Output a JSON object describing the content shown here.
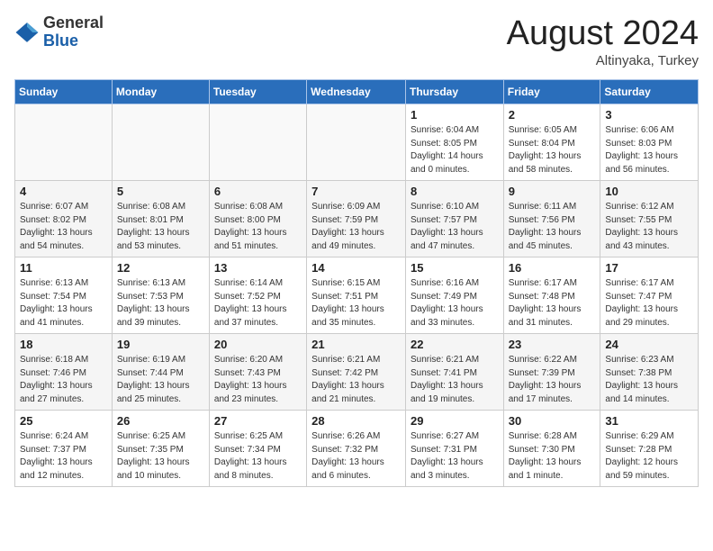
{
  "header": {
    "logo_general": "General",
    "logo_blue": "Blue",
    "month_title": "August 2024",
    "location": "Altinyaka, Turkey"
  },
  "weekdays": [
    "Sunday",
    "Monday",
    "Tuesday",
    "Wednesday",
    "Thursday",
    "Friday",
    "Saturday"
  ],
  "weeks": [
    [
      {
        "day": "",
        "info": ""
      },
      {
        "day": "",
        "info": ""
      },
      {
        "day": "",
        "info": ""
      },
      {
        "day": "",
        "info": ""
      },
      {
        "day": "1",
        "info": "Sunrise: 6:04 AM\nSunset: 8:05 PM\nDaylight: 14 hours\nand 0 minutes."
      },
      {
        "day": "2",
        "info": "Sunrise: 6:05 AM\nSunset: 8:04 PM\nDaylight: 13 hours\nand 58 minutes."
      },
      {
        "day": "3",
        "info": "Sunrise: 6:06 AM\nSunset: 8:03 PM\nDaylight: 13 hours\nand 56 minutes."
      }
    ],
    [
      {
        "day": "4",
        "info": "Sunrise: 6:07 AM\nSunset: 8:02 PM\nDaylight: 13 hours\nand 54 minutes."
      },
      {
        "day": "5",
        "info": "Sunrise: 6:08 AM\nSunset: 8:01 PM\nDaylight: 13 hours\nand 53 minutes."
      },
      {
        "day": "6",
        "info": "Sunrise: 6:08 AM\nSunset: 8:00 PM\nDaylight: 13 hours\nand 51 minutes."
      },
      {
        "day": "7",
        "info": "Sunrise: 6:09 AM\nSunset: 7:59 PM\nDaylight: 13 hours\nand 49 minutes."
      },
      {
        "day": "8",
        "info": "Sunrise: 6:10 AM\nSunset: 7:57 PM\nDaylight: 13 hours\nand 47 minutes."
      },
      {
        "day": "9",
        "info": "Sunrise: 6:11 AM\nSunset: 7:56 PM\nDaylight: 13 hours\nand 45 minutes."
      },
      {
        "day": "10",
        "info": "Sunrise: 6:12 AM\nSunset: 7:55 PM\nDaylight: 13 hours\nand 43 minutes."
      }
    ],
    [
      {
        "day": "11",
        "info": "Sunrise: 6:13 AM\nSunset: 7:54 PM\nDaylight: 13 hours\nand 41 minutes."
      },
      {
        "day": "12",
        "info": "Sunrise: 6:13 AM\nSunset: 7:53 PM\nDaylight: 13 hours\nand 39 minutes."
      },
      {
        "day": "13",
        "info": "Sunrise: 6:14 AM\nSunset: 7:52 PM\nDaylight: 13 hours\nand 37 minutes."
      },
      {
        "day": "14",
        "info": "Sunrise: 6:15 AM\nSunset: 7:51 PM\nDaylight: 13 hours\nand 35 minutes."
      },
      {
        "day": "15",
        "info": "Sunrise: 6:16 AM\nSunset: 7:49 PM\nDaylight: 13 hours\nand 33 minutes."
      },
      {
        "day": "16",
        "info": "Sunrise: 6:17 AM\nSunset: 7:48 PM\nDaylight: 13 hours\nand 31 minutes."
      },
      {
        "day": "17",
        "info": "Sunrise: 6:17 AM\nSunset: 7:47 PM\nDaylight: 13 hours\nand 29 minutes."
      }
    ],
    [
      {
        "day": "18",
        "info": "Sunrise: 6:18 AM\nSunset: 7:46 PM\nDaylight: 13 hours\nand 27 minutes."
      },
      {
        "day": "19",
        "info": "Sunrise: 6:19 AM\nSunset: 7:44 PM\nDaylight: 13 hours\nand 25 minutes."
      },
      {
        "day": "20",
        "info": "Sunrise: 6:20 AM\nSunset: 7:43 PM\nDaylight: 13 hours\nand 23 minutes."
      },
      {
        "day": "21",
        "info": "Sunrise: 6:21 AM\nSunset: 7:42 PM\nDaylight: 13 hours\nand 21 minutes."
      },
      {
        "day": "22",
        "info": "Sunrise: 6:21 AM\nSunset: 7:41 PM\nDaylight: 13 hours\nand 19 minutes."
      },
      {
        "day": "23",
        "info": "Sunrise: 6:22 AM\nSunset: 7:39 PM\nDaylight: 13 hours\nand 17 minutes."
      },
      {
        "day": "24",
        "info": "Sunrise: 6:23 AM\nSunset: 7:38 PM\nDaylight: 13 hours\nand 14 minutes."
      }
    ],
    [
      {
        "day": "25",
        "info": "Sunrise: 6:24 AM\nSunset: 7:37 PM\nDaylight: 13 hours\nand 12 minutes."
      },
      {
        "day": "26",
        "info": "Sunrise: 6:25 AM\nSunset: 7:35 PM\nDaylight: 13 hours\nand 10 minutes."
      },
      {
        "day": "27",
        "info": "Sunrise: 6:25 AM\nSunset: 7:34 PM\nDaylight: 13 hours\nand 8 minutes."
      },
      {
        "day": "28",
        "info": "Sunrise: 6:26 AM\nSunset: 7:32 PM\nDaylight: 13 hours\nand 6 minutes."
      },
      {
        "day": "29",
        "info": "Sunrise: 6:27 AM\nSunset: 7:31 PM\nDaylight: 13 hours\nand 3 minutes."
      },
      {
        "day": "30",
        "info": "Sunrise: 6:28 AM\nSunset: 7:30 PM\nDaylight: 13 hours\nand 1 minute."
      },
      {
        "day": "31",
        "info": "Sunrise: 6:29 AM\nSunset: 7:28 PM\nDaylight: 12 hours\nand 59 minutes."
      }
    ]
  ]
}
